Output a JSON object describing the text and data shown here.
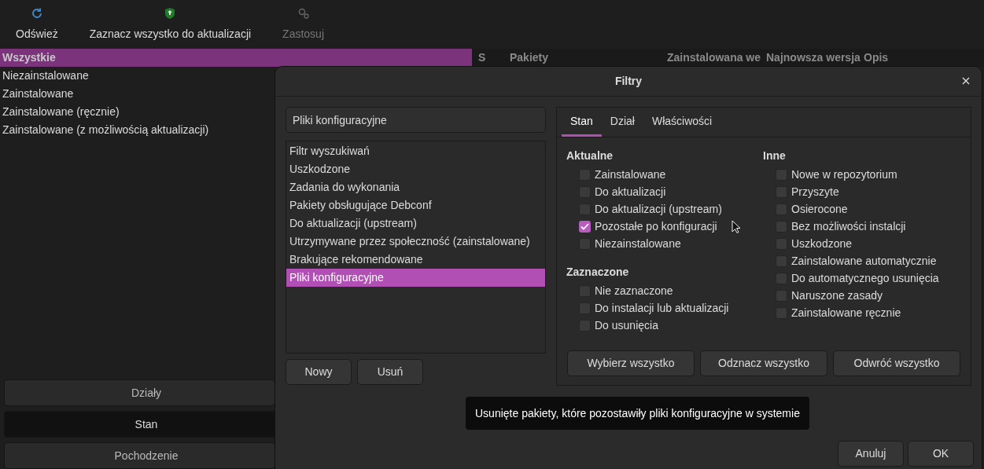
{
  "toolbar": [
    {
      "kind": "refresh",
      "label": "Odśwież",
      "disabled": false
    },
    {
      "kind": "upgrade",
      "label": "Zaznacz wszystko do aktualizacji",
      "disabled": false
    },
    {
      "kind": "apply",
      "label": "Zastosuj",
      "disabled": true
    }
  ],
  "categories": [
    {
      "label": "Wszystkie",
      "selected": true
    },
    {
      "label": "Niezainstalowane",
      "selected": false
    },
    {
      "label": "Zainstalowane",
      "selected": false
    },
    {
      "label": "Zainstalowane (ręcznie)",
      "selected": false
    },
    {
      "label": "Zainstalowane (z możliwością aktualizacji)",
      "selected": false
    }
  ],
  "table": {
    "columns": [
      "S",
      "Pakiety",
      "Zainstalowana we",
      "Najnowsza wersja",
      "Opis"
    ]
  },
  "view_buttons": [
    {
      "label": "Działy",
      "selected": false
    },
    {
      "label": "Stan",
      "selected": true
    },
    {
      "label": "Pochodzenie",
      "selected": false
    }
  ],
  "dialog": {
    "title": "Filtry",
    "filter_name": {
      "value": "Pliki konfiguracyjne"
    },
    "filters": [
      {
        "label": "Filtr wyszukiwań",
        "selected": false
      },
      {
        "label": "Uszkodzone",
        "selected": false
      },
      {
        "label": "Zadania do wykonania",
        "selected": false
      },
      {
        "label": "Pakiety obsługujące Debconf",
        "selected": false
      },
      {
        "label": "Do aktualizacji (upstream)",
        "selected": false
      },
      {
        "label": "Utrzymywane przez społeczność (zainstalowane)",
        "selected": false
      },
      {
        "label": "Brakujące rekomendowane",
        "selected": false
      },
      {
        "label": "Pliki konfiguracyjne",
        "selected": true
      }
    ],
    "list_buttons": [
      "Nowy",
      "Usuń"
    ],
    "tabs": [
      {
        "label": "Stan",
        "selected": true
      },
      {
        "label": "Dział",
        "selected": false
      },
      {
        "label": "Właściwości",
        "selected": false
      }
    ],
    "columns": [
      [
        {
          "heading": "Aktualne",
          "options": [
            {
              "label": "Zainstalowane",
              "checked": false
            },
            {
              "label": "Do aktualizacji",
              "checked": false
            },
            {
              "label": "Do aktualizacji (upstream)",
              "checked": false
            },
            {
              "label": "Pozostałe po konfiguracji",
              "checked": true
            },
            {
              "label": "Niezainstalowane",
              "checked": false
            }
          ]
        },
        {
          "heading": "Zaznaczone",
          "options": [
            {
              "label": "Nie zaznaczone",
              "checked": false
            },
            {
              "label": "Do instalacji lub aktualizacji",
              "checked": false
            },
            {
              "label": "Do usunięcia",
              "checked": false
            }
          ]
        }
      ],
      [
        {
          "heading": "Inne",
          "options": [
            {
              "label": "Nowe w repozytorium",
              "checked": false
            },
            {
              "label": "Przyszyte",
              "checked": false
            },
            {
              "label": "Osierocone",
              "checked": false
            },
            {
              "label": "Bez możliwości instalcji",
              "checked": false
            },
            {
              "label": "Uszkodzone",
              "checked": false
            },
            {
              "label": "Zainstalowane automatycznie",
              "checked": false
            },
            {
              "label": "Do automatycznego usunięcia",
              "checked": false
            },
            {
              "label": "Naruszone zasady",
              "checked": false
            },
            {
              "label": "Zainstalowane ręcznie",
              "checked": false
            }
          ]
        }
      ]
    ],
    "panel_buttons": [
      "Wybierz wszystko",
      "Odznacz wszystko",
      "Odwróć wszystko"
    ],
    "tooltip": "Usunięte pakiety, które pozostawiły pliki konfiguracyjne w systemie",
    "buttons": [
      "Anuluj",
      "OK"
    ]
  }
}
